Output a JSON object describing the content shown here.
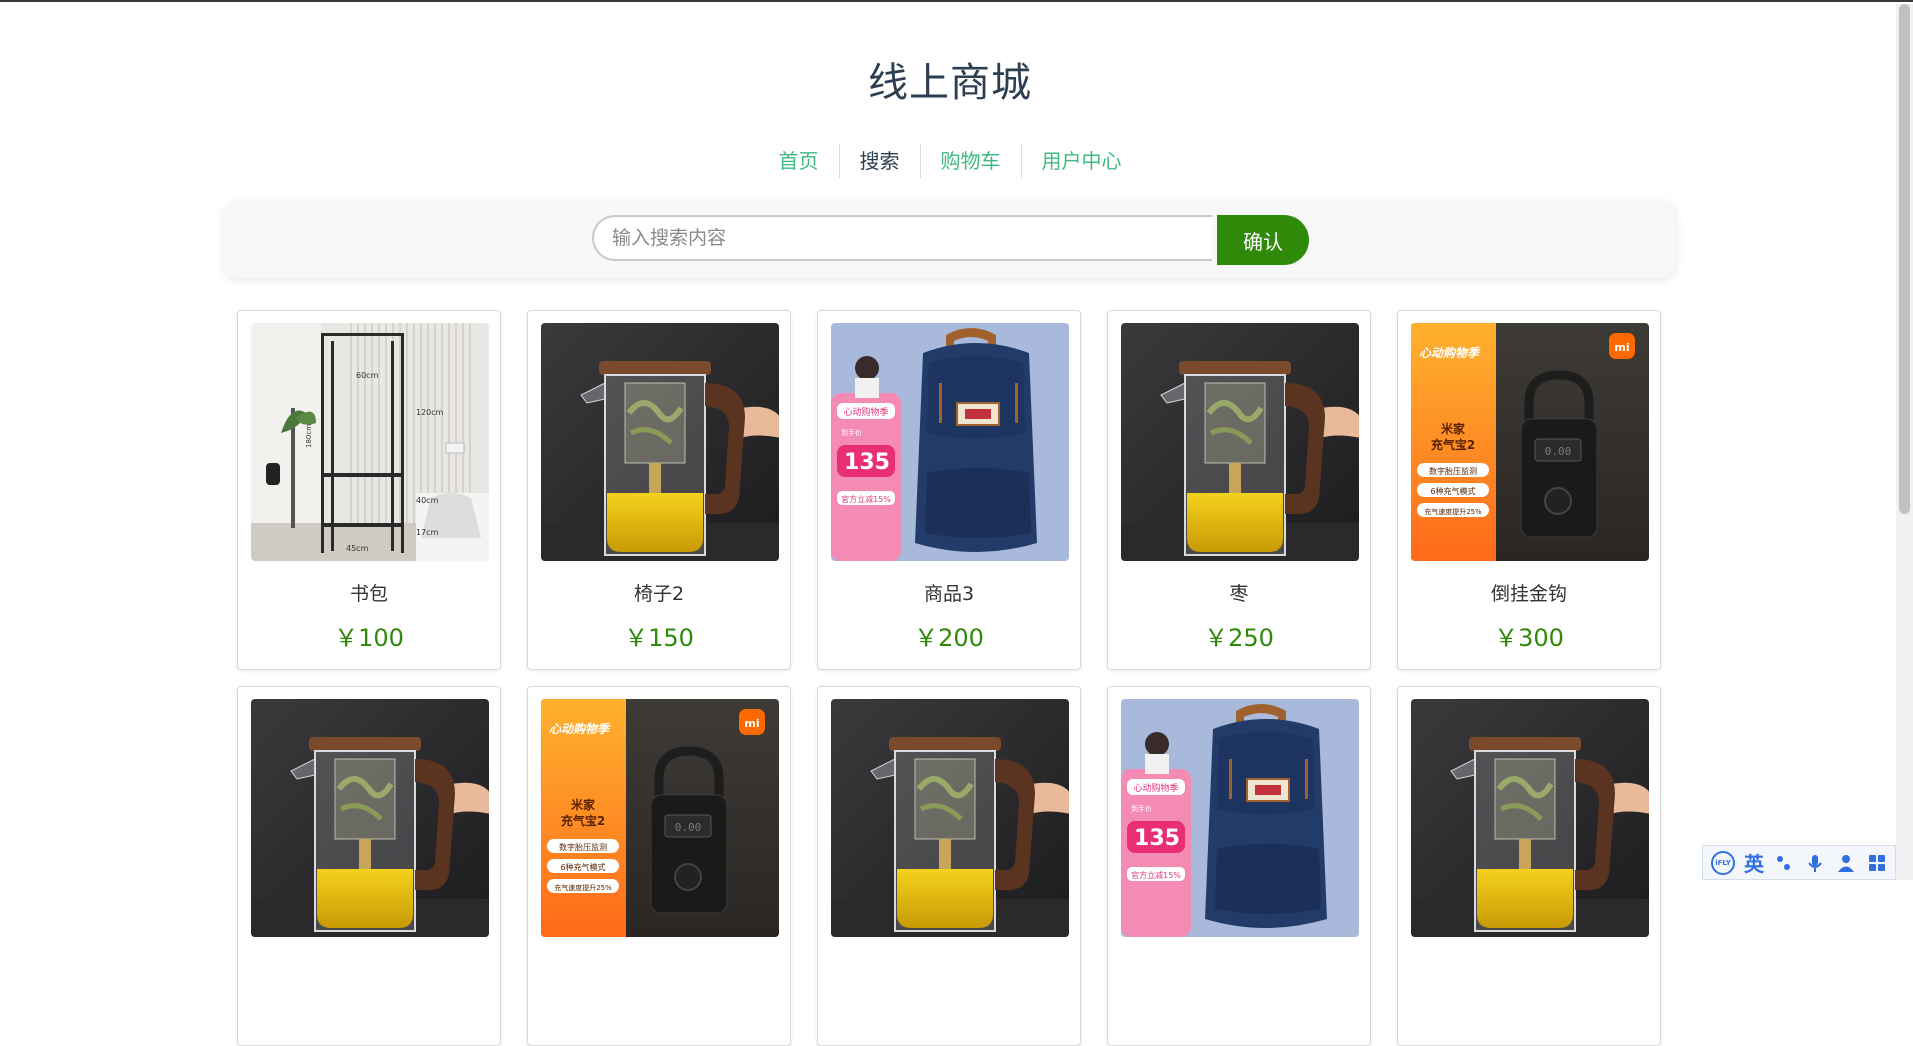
{
  "header": {
    "title": "线上商城"
  },
  "nav": {
    "items": [
      {
        "label": "首页"
      },
      {
        "label": "搜索"
      },
      {
        "label": "购物车"
      },
      {
        "label": "用户中心"
      }
    ],
    "active_index": 1
  },
  "search": {
    "placeholder": "输入搜索内容",
    "value": "",
    "button_label": "确认"
  },
  "products": [
    {
      "name": "书包",
      "price": "￥100",
      "image": "shelf"
    },
    {
      "name": "椅子2",
      "price": "￥150",
      "image": "teapot"
    },
    {
      "name": "商品3",
      "price": "￥200",
      "image": "backpack"
    },
    {
      "name": "枣",
      "price": "￥250",
      "image": "teapot"
    },
    {
      "name": "倒挂金钩",
      "price": "￥300",
      "image": "pump"
    },
    {
      "name": "",
      "price": "",
      "image": "teapot"
    },
    {
      "name": "",
      "price": "",
      "image": "pump"
    },
    {
      "name": "",
      "price": "",
      "image": "teapot"
    },
    {
      "name": "",
      "price": "",
      "image": "backpack"
    },
    {
      "name": "",
      "price": "",
      "image": "teapot"
    }
  ],
  "image_text": {
    "shelf": {
      "w": "60cm",
      "h1": "120cm",
      "h2": "40cm",
      "h3": "17cm",
      "side": "180cm",
      "base": "45cm"
    },
    "backpack": {
      "banner": "心动购物季",
      "price": "135",
      "tag1": "官方立减15%",
      "tag2": "到手价"
    },
    "pump": {
      "banner": "心动购物季",
      "brand": "米家",
      "model": "充气宝2",
      "f1": "数字胎压监测",
      "f2": "6种充气模式",
      "f3": "充气速度提升25%",
      "logo": "mi"
    }
  },
  "ime": {
    "logo": "iFLY",
    "mode": "英"
  },
  "colors": {
    "accent": "#42b983",
    "button": "#2f8a0a",
    "price": "#2f8a0a",
    "title": "#2c3e50"
  }
}
